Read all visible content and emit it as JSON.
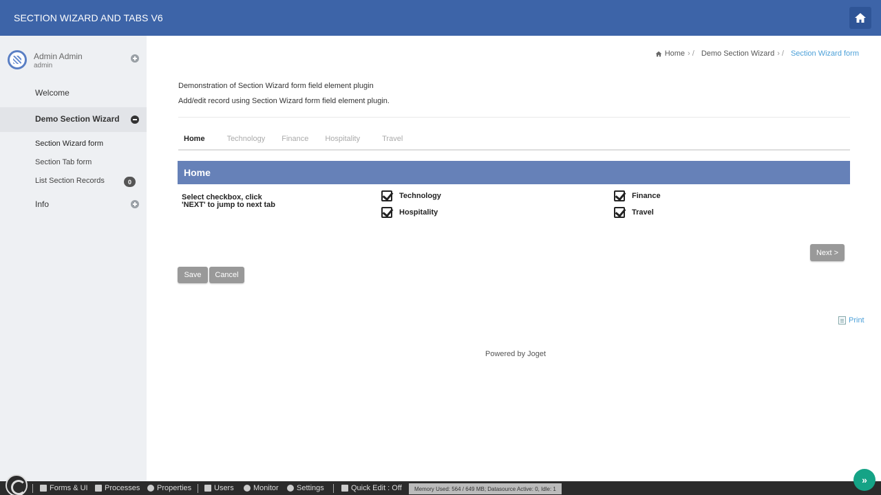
{
  "header": {
    "title": "SECTION WIZARD AND TABS V6",
    "home_icon": "home-icon"
  },
  "user": {
    "name": "Admin Admin",
    "username": "admin"
  },
  "sidebar": {
    "items": [
      {
        "label": "Welcome"
      },
      {
        "label": "Demo Section Wizard"
      },
      {
        "label": "Section Wizard form"
      },
      {
        "label": "Section Tab form"
      },
      {
        "label": "List Section Records",
        "badge": "0"
      },
      {
        "label": "Info"
      }
    ]
  },
  "breadcrumb": {
    "home": "Home",
    "parent": "Demo Section Wizard",
    "current": "Section Wizard form"
  },
  "main": {
    "desc1": "Demonstration of Section Wizard form field element plugin",
    "desc2": "Add/edit record using Section Wizard form field element plugin.",
    "tabs": [
      "Home",
      "Technology",
      "Finance",
      "Hospitality",
      "Travel"
    ],
    "section_title": "Home",
    "field_label": "Select checkbox, click 'NEXT' to jump to next tab",
    "checkboxes": [
      {
        "label": "Technology",
        "checked": true
      },
      {
        "label": "Finance",
        "checked": true
      },
      {
        "label": "Hospitality",
        "checked": true
      },
      {
        "label": "Travel",
        "checked": true
      }
    ],
    "next_label": "Next >",
    "save_label": "Save",
    "cancel_label": "Cancel",
    "print_label": "Print",
    "powered_by": "Powered by Joget"
  },
  "adminbar": {
    "items": [
      "Forms & UI",
      "Processes",
      "Properties",
      "Users",
      "Monitor",
      "Settings",
      "Quick Edit : Off"
    ],
    "memory": "Memory Used: 564 / 649 MB; Datasource Active: 0, Idle: 1"
  },
  "colors": {
    "header": "#3d64a8",
    "section": "#6681b8",
    "link": "#4a9fd8",
    "fab": "#15a386"
  }
}
